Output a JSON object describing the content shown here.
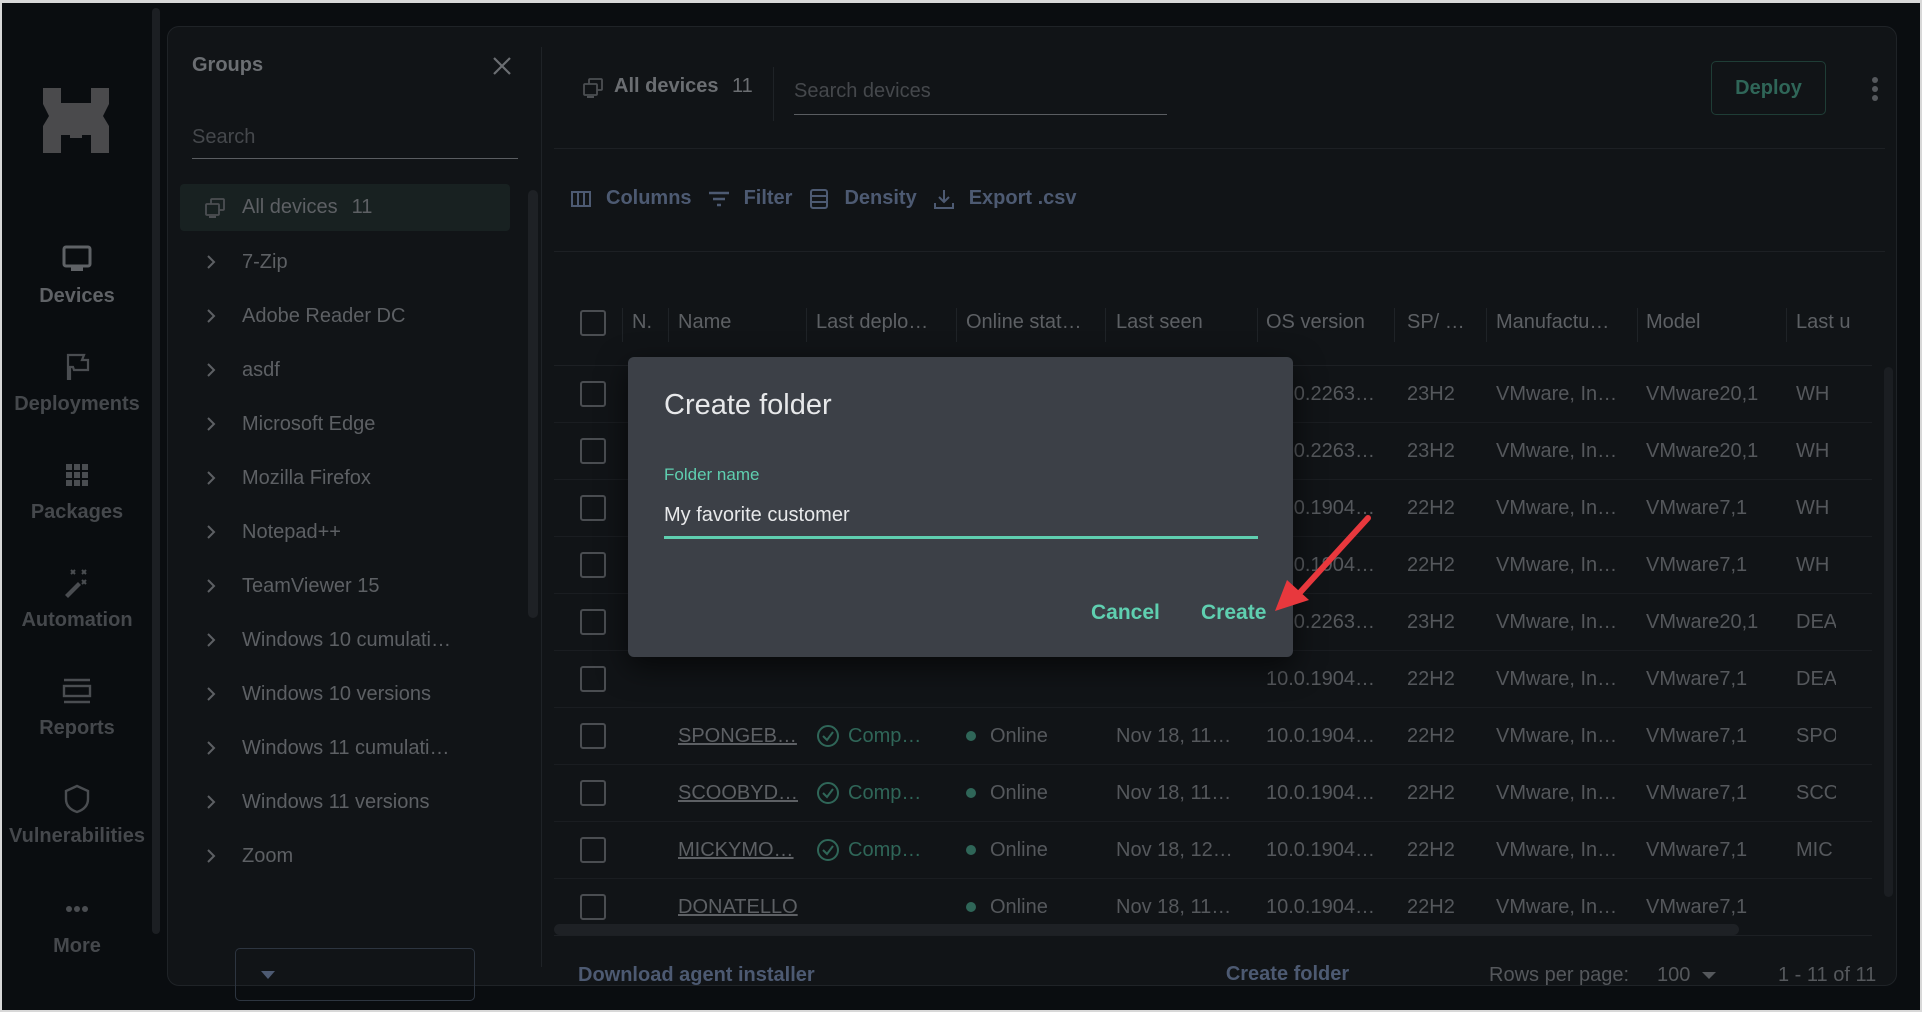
{
  "nav": {
    "items": [
      {
        "label": "Devices",
        "icon": "monitor-icon",
        "active": true
      },
      {
        "label": "Deployments",
        "icon": "flag-icon"
      },
      {
        "label": "Packages",
        "icon": "grid-icon"
      },
      {
        "label": "Automation",
        "icon": "magic-wand-icon"
      },
      {
        "label": "Reports",
        "icon": "reports-icon"
      },
      {
        "label": "Vulnerabilities",
        "icon": "shield-icon"
      },
      {
        "label": "More",
        "icon": "more-horizontal-icon"
      }
    ]
  },
  "groups": {
    "title": "Groups",
    "search_placeholder": "Search",
    "all_devices": {
      "label": "All devices",
      "count": "11"
    },
    "items": [
      "7-Zip",
      "Adobe Reader DC",
      "asdf",
      "Microsoft Edge",
      "Mozilla Firefox",
      "Notepad++",
      "TeamViewer 15",
      "Windows 10 cumulati…",
      "Windows 10 versions",
      "Windows 11 cumulati…",
      "Windows 11 versions",
      "Zoom"
    ],
    "create_folder_label": "Create folder"
  },
  "header": {
    "title": "All devices",
    "count": "11",
    "search_placeholder": "Search devices",
    "deploy_label": "Deploy"
  },
  "toolbar": {
    "columns": "Columns",
    "filter": "Filter",
    "density": "Density",
    "export": "Export .csv"
  },
  "table": {
    "columns": [
      "N.",
      "Name",
      "Last deplo…",
      "Online stat…",
      "Last seen",
      "OS version",
      "SP/ …",
      "Manufactu…",
      "Model",
      "Last u"
    ],
    "rows": [
      {
        "name": "",
        "deploy": "",
        "online": "",
        "last_seen": "",
        "os": "10.0.2263…",
        "sp": "23H2",
        "manufacturer": "VMware, In…",
        "model": "VMware20,1",
        "last_user": "WH"
      },
      {
        "name": "",
        "deploy": "",
        "online": "",
        "last_seen": "",
        "os": "10.0.2263…",
        "sp": "23H2",
        "manufacturer": "VMware, In…",
        "model": "VMware20,1",
        "last_user": "WH"
      },
      {
        "name": "",
        "deploy": "",
        "online": "",
        "last_seen": "",
        "os": "10.0.1904…",
        "sp": "22H2",
        "manufacturer": "VMware, In…",
        "model": "VMware7,1",
        "last_user": "WH"
      },
      {
        "name": "",
        "deploy": "",
        "online": "",
        "last_seen": "",
        "os": "10.0.1904…",
        "sp": "22H2",
        "manufacturer": "VMware, In…",
        "model": "VMware7,1",
        "last_user": "WH"
      },
      {
        "name": "",
        "deploy": "",
        "online": "",
        "last_seen": "",
        "os": "10.0.2263…",
        "sp": "23H2",
        "manufacturer": "VMware, In…",
        "model": "VMware20,1",
        "last_user": "DEA"
      },
      {
        "name": "",
        "deploy": "",
        "online": "",
        "last_seen": "",
        "os": "10.0.1904…",
        "sp": "22H2",
        "manufacturer": "VMware, In…",
        "model": "VMware7,1",
        "last_user": "DEA"
      },
      {
        "name": "SPONGEB…",
        "deploy": "Comp…",
        "online": "Online",
        "last_seen": "Nov 18, 11…",
        "os": "10.0.1904…",
        "sp": "22H2",
        "manufacturer": "VMware, In…",
        "model": "VMware7,1",
        "last_user": "SPO"
      },
      {
        "name": "SCOOBYD…",
        "deploy": "Comp…",
        "online": "Online",
        "last_seen": "Nov 18, 11…",
        "os": "10.0.1904…",
        "sp": "22H2",
        "manufacturer": "VMware, In…",
        "model": "VMware7,1",
        "last_user": "SCO"
      },
      {
        "name": "MICKYMO…",
        "deploy": "Comp…",
        "online": "Online",
        "last_seen": "Nov 18, 12…",
        "os": "10.0.1904…",
        "sp": "22H2",
        "manufacturer": "VMware, In…",
        "model": "VMware7,1",
        "last_user": "MIC"
      },
      {
        "name": "DONATELLO",
        "deploy": "",
        "online": "Online",
        "last_seen": "Nov 18, 11…",
        "os": "10.0.1904…",
        "sp": "22H2",
        "manufacturer": "VMware, In…",
        "model": "VMware7,1",
        "last_user": ""
      }
    ]
  },
  "footer": {
    "download_label": "Download agent installer",
    "rows_per_page_label": "Rows per page:",
    "rows_per_page_value": "100",
    "range": "1 - 11 of 11"
  },
  "dialog": {
    "title": "Create folder",
    "field_label": "Folder name",
    "field_value": "My favorite customer",
    "cancel_label": "Cancel",
    "create_label": "Create"
  },
  "colors": {
    "accent": "#5fcfb0",
    "deploy_green": "#2f6658",
    "link_blue": "#4d5a72",
    "dialog_bg": "#3c4047",
    "annotation_arrow": "#e8383d"
  }
}
